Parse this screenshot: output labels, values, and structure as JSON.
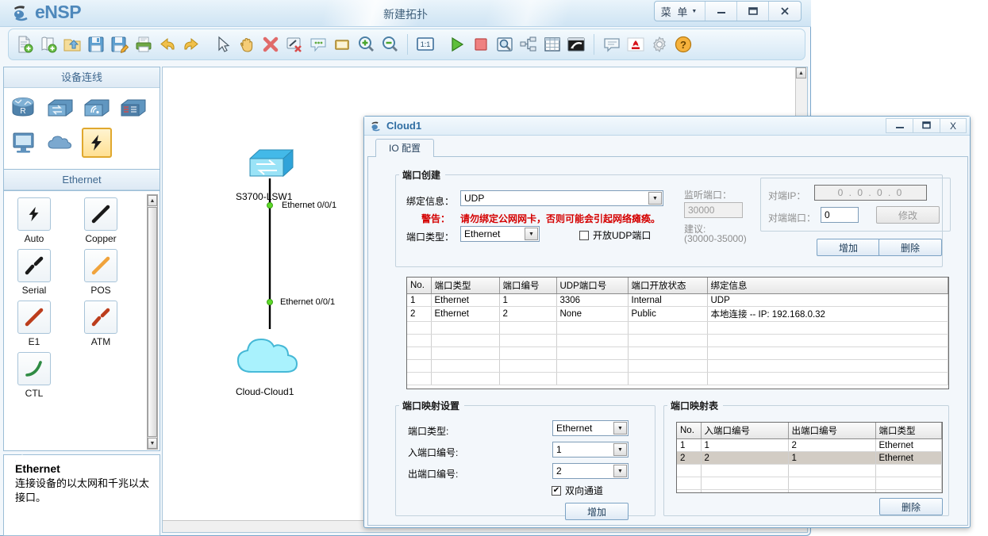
{
  "app": {
    "brand": "eNSP",
    "title": "新建拓扑",
    "menu_label": "菜 单",
    "minimize": "_",
    "maximize": "❐",
    "close": "✕"
  },
  "toolbar": {
    "items": [
      {
        "name": "new-topology-icon",
        "tip": "新建拓扑"
      },
      {
        "name": "new-scenario-icon",
        "tip": "新建试卷"
      },
      {
        "name": "open-icon",
        "tip": "打开"
      },
      {
        "name": "save-icon",
        "tip": "保存"
      },
      {
        "name": "save-as-icon",
        "tip": "另存为"
      },
      {
        "name": "print-icon",
        "tip": "打印"
      },
      {
        "name": "undo-icon",
        "tip": "撤销"
      },
      {
        "name": "redo-icon",
        "tip": "恢复"
      },
      {
        "name": "select-cursor-icon",
        "tip": "选择"
      },
      {
        "name": "pan-hand-icon",
        "tip": "移动"
      },
      {
        "name": "delete-icon",
        "tip": "删除"
      },
      {
        "name": "remove-link-icon",
        "tip": "删除连线"
      },
      {
        "name": "comment-icon",
        "tip": "添加描述"
      },
      {
        "name": "rectangle-icon",
        "tip": "添加图形"
      },
      {
        "name": "zoom-in-icon",
        "tip": "放大"
      },
      {
        "name": "zoom-out-icon",
        "tip": "缩小"
      },
      {
        "name": "zoom-reset-icon",
        "tip": "1:1",
        "label": "1:1"
      },
      {
        "name": "start-device-icon",
        "tip": "开启设备"
      },
      {
        "name": "stop-device-icon",
        "tip": "关闭设备"
      },
      {
        "name": "packet-capture-icon",
        "tip": "数据抓包"
      },
      {
        "name": "topology-tree-icon",
        "tip": "拓扑树"
      },
      {
        "name": "grid-icon",
        "tip": "网格"
      },
      {
        "name": "console-icon",
        "tip": "命令行"
      },
      {
        "name": "chat-icon",
        "tip": "论坛"
      },
      {
        "name": "huawei-logo-icon",
        "tip": "华为"
      },
      {
        "name": "settings-gear-icon",
        "tip": "设置"
      },
      {
        "name": "help-icon",
        "tip": "帮助"
      }
    ]
  },
  "sidebar": {
    "devices_header": "设备连线",
    "device_icons": [
      {
        "name": "router-icon",
        "label": "路由器"
      },
      {
        "name": "switch-icon",
        "label": "交换机"
      },
      {
        "name": "wlan-icon",
        "label": "无线局域网"
      },
      {
        "name": "firewall-icon",
        "label": "防火墙"
      },
      {
        "name": "endpoint-icon",
        "label": "终端"
      },
      {
        "name": "cloud-icon",
        "label": "其他设备"
      },
      {
        "name": "connection-icon",
        "label": "设备连线"
      }
    ],
    "category_header": "Ethernet",
    "cables": [
      {
        "name": "cable-auto",
        "label": "Auto"
      },
      {
        "name": "cable-copper",
        "label": "Copper"
      },
      {
        "name": "cable-serial",
        "label": "Serial"
      },
      {
        "name": "cable-pos",
        "label": "POS"
      },
      {
        "name": "cable-e1",
        "label": "E1"
      },
      {
        "name": "cable-atm",
        "label": "ATM"
      },
      {
        "name": "cable-ctl",
        "label": "CTL"
      }
    ],
    "description": {
      "title": "Ethernet",
      "text": "连接设备的以太网和千兆以太接口。"
    }
  },
  "canvas": {
    "nodes": [
      {
        "name": "switch-node",
        "label": "S3700-LSW1"
      },
      {
        "name": "cloud-node",
        "label": "Cloud-Cloud1"
      }
    ],
    "port_labels": [
      "Ethernet 0/0/1",
      "Ethernet 0/0/1"
    ]
  },
  "dialog": {
    "title": "Cloud1",
    "minimize": "_",
    "maximize": "❐",
    "close": "X",
    "tab_label": "IO 配置",
    "port_create": {
      "legend": "端口创建",
      "binding_label": "绑定信息：",
      "binding_value": "UDP",
      "warning_label": "警告：",
      "warning_text": "请勿绑定公网网卡，否则可能会引起网络瘫痪。",
      "port_type_label": "端口类型：",
      "port_type_value": "Ethernet",
      "open_udp_label": "开放UDP端口",
      "open_udp_checked": false,
      "listen_port_label": "监听端口：",
      "listen_port_value": "30000",
      "suggest_label": "建议:",
      "suggest_range": "(30000-35000)",
      "peer_ip_label": "对端IP：",
      "peer_ip_value": "0 . 0 . 0 . 0",
      "peer_port_label": "对端端口：",
      "peer_port_value": "0",
      "modify_button": "修改",
      "add_button": "增加",
      "delete_button": "删除"
    },
    "port_table": {
      "headers": [
        "No.",
        "端口类型",
        "端口编号",
        "UDP端口号",
        "端口开放状态",
        "绑定信息"
      ],
      "rows": [
        [
          "1",
          "Ethernet",
          "1",
          "3306",
          "Internal",
          "UDP"
        ],
        [
          "2",
          "Ethernet",
          "2",
          "None",
          "Public",
          "本地连接 -- IP: 192.168.0.32"
        ]
      ],
      "empty_rows": 5
    },
    "mapping_settings": {
      "legend": "端口映射设置",
      "port_type_label": "端口类型:",
      "port_type_value": "Ethernet",
      "in_port_label": "入端口编号:",
      "in_port_value": "1",
      "out_port_label": "出端口编号:",
      "out_port_value": "2",
      "bidirectional_label": "双向通道",
      "bidirectional_checked": true,
      "add_button": "增加"
    },
    "mapping_table": {
      "legend": "端口映射表",
      "headers": [
        "No.",
        "入端口编号",
        "出端口编号",
        "端口类型"
      ],
      "rows": [
        {
          "cells": [
            "1",
            "1",
            "2",
            "Ethernet"
          ],
          "selected": false
        },
        {
          "cells": [
            "2",
            "2",
            "1",
            "Ethernet"
          ],
          "selected": true
        }
      ],
      "empty_rows": 3,
      "delete_button": "删除"
    }
  },
  "colors": {
    "accent": "#4e88bb",
    "warning": "#d40000",
    "link_dot": "#5ed92a",
    "cloud_fill": "#9ef0fb",
    "switch_fill": "#8fdcf5"
  }
}
